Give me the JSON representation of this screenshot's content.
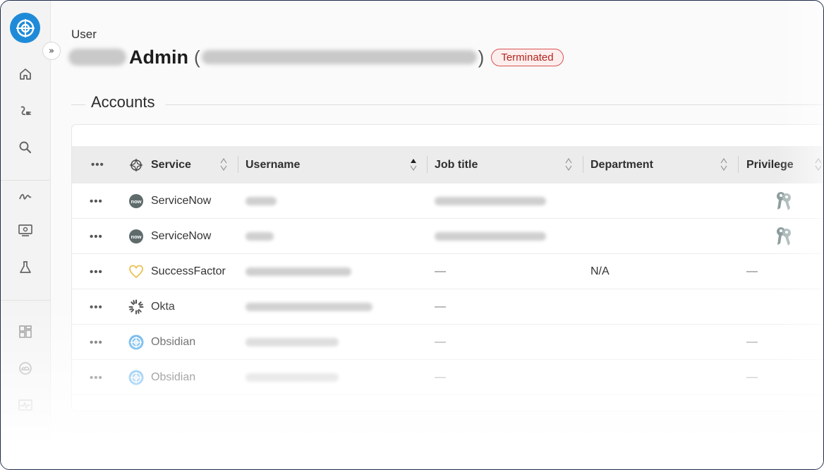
{
  "header": {
    "breadcrumb": "User",
    "title_name": "Admin",
    "status_badge": "Terminated"
  },
  "colors": {
    "accent": "#1f8bd8",
    "badge_border": "#d9534f",
    "badge_text": "#b3261e"
  },
  "sidebar": {
    "expand_label": "»",
    "icons": [
      "home-icon",
      "integrations-icon",
      "search-icon",
      "activity-icon",
      "monitor-icon",
      "lab-icon",
      "dashboard-icon",
      "cloud-icon",
      "pulse-icon"
    ]
  },
  "section": {
    "title": "Accounts"
  },
  "table": {
    "columns": [
      "Service",
      "Username",
      "Job title",
      "Department",
      "Privilege"
    ],
    "row_menu": "•••",
    "rows": [
      {
        "service": "ServiceNow",
        "icon": "servicenow-icon",
        "job_title": "",
        "department": "",
        "privilege": "keys-icon"
      },
      {
        "service": "ServiceNow",
        "icon": "servicenow-icon",
        "job_title": "",
        "department": "",
        "privilege": "keys-icon"
      },
      {
        "service": "SuccessFactor",
        "icon": "successfactor-icon",
        "job_title": "—",
        "department": "N/A",
        "privilege": "—"
      },
      {
        "service": "Okta",
        "icon": "okta-icon",
        "job_title": "—",
        "department": "",
        "privilege": ""
      },
      {
        "service": "Obsidian",
        "icon": "obsidian-icon",
        "job_title": "—",
        "department": "",
        "privilege": "—"
      },
      {
        "service": "Obsidian",
        "icon": "obsidian-icon",
        "job_title": "—",
        "department": "",
        "privilege": "—"
      }
    ]
  }
}
